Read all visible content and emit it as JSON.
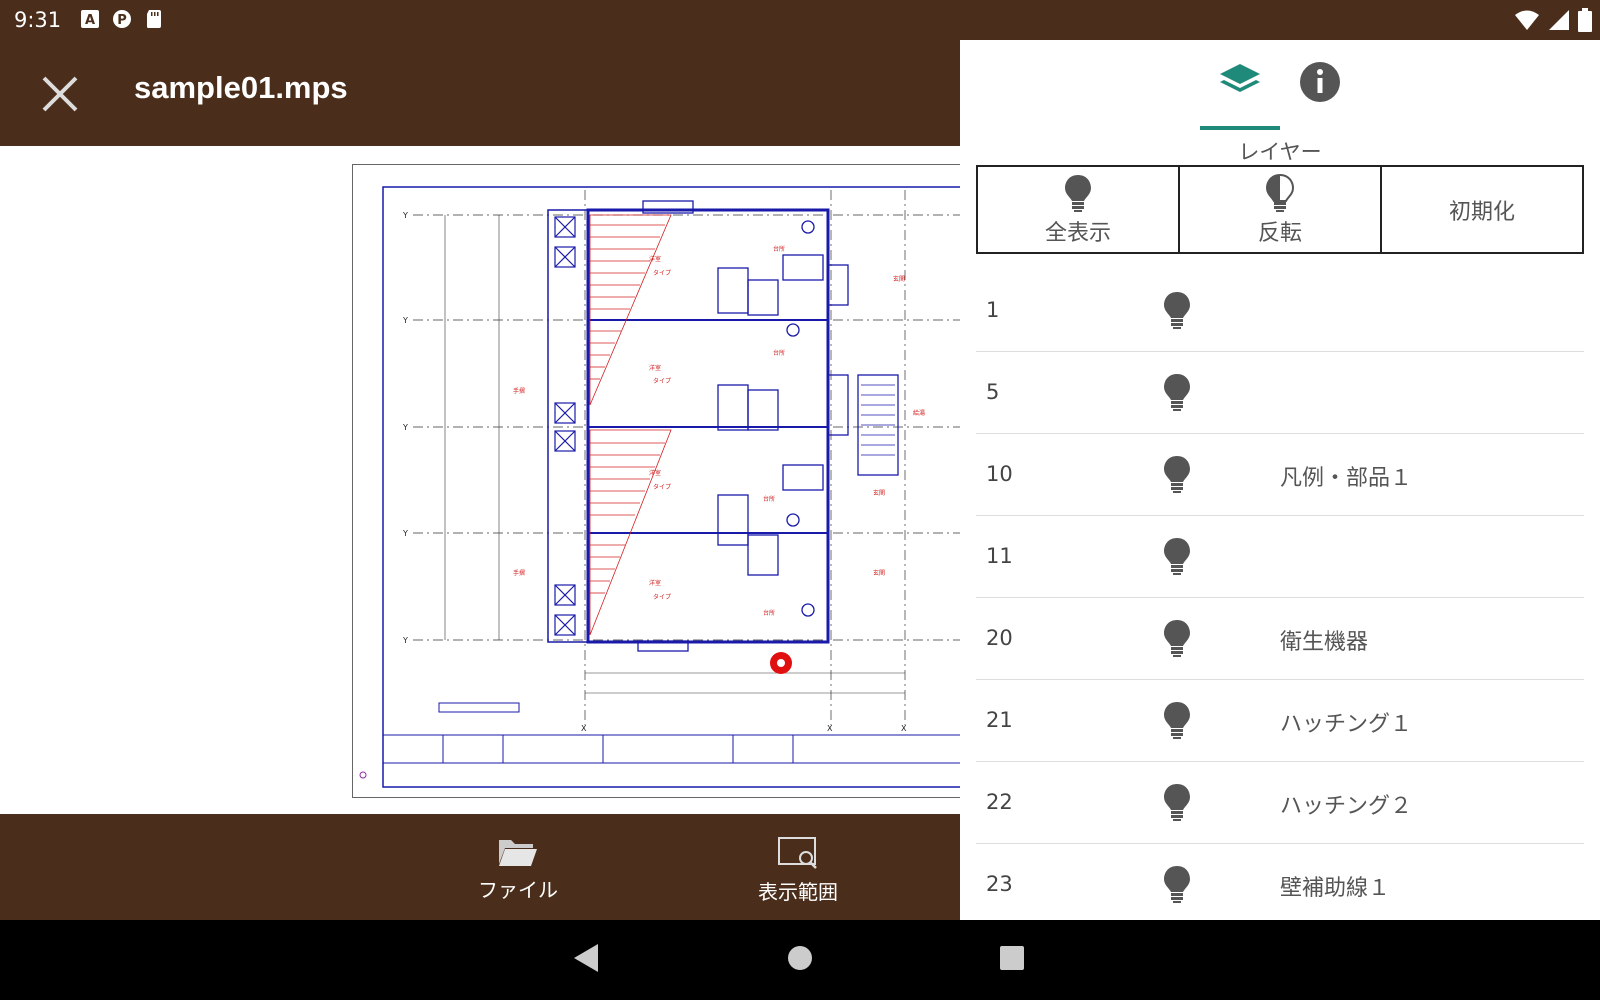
{
  "status": {
    "time": "9:31",
    "icons": [
      "a-box-icon",
      "p-circle-icon",
      "sd-card-icon"
    ],
    "right_icons": [
      "wifi-icon",
      "signal-icon",
      "battery-icon"
    ]
  },
  "appbar": {
    "title": "sample01.mps",
    "close_icon": "close-icon"
  },
  "bottombar": {
    "file_label": "ファイル",
    "range_label": "表示範囲"
  },
  "panel": {
    "heading": "レイヤー",
    "tabs": [
      {
        "icon": "layers-icon",
        "active": true
      },
      {
        "icon": "info-icon",
        "active": false
      }
    ],
    "buttons": {
      "show_all": "全表示",
      "invert": "反転",
      "reset": "初期化"
    },
    "layers": [
      {
        "num": "1",
        "name": ""
      },
      {
        "num": "5",
        "name": ""
      },
      {
        "num": "10",
        "name": "凡例・部品１"
      },
      {
        "num": "11",
        "name": ""
      },
      {
        "num": "20",
        "name": "衛生機器"
      },
      {
        "num": "21",
        "name": "ハッチング１"
      },
      {
        "num": "22",
        "name": "ハッチング２"
      },
      {
        "num": "23",
        "name": "壁補助線１"
      }
    ]
  },
  "colors": {
    "brand_brown": "#4a2e1b",
    "accent_teal": "#1f8a7a",
    "drawing_blue": "#1a1aaa",
    "drawing_red": "#d22020"
  }
}
